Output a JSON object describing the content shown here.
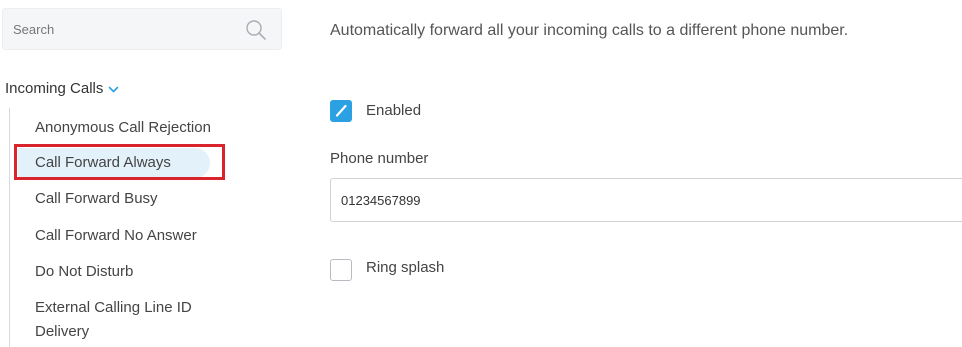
{
  "sidebar": {
    "search": {
      "placeholder": "Search",
      "value": ""
    },
    "section": {
      "title": "Incoming Calls"
    },
    "items": [
      {
        "label": "Anonymous Call Rejection"
      },
      {
        "label": "Call Forward Always"
      },
      {
        "label": "Call Forward Busy"
      },
      {
        "label": "Call Forward No Answer"
      },
      {
        "label": "Do Not Disturb"
      },
      {
        "label": "External Calling Line ID"
      },
      {
        "label": "Delivery"
      }
    ]
  },
  "main": {
    "description": "Automatically forward all your incoming calls to a different phone number.",
    "enabled": {
      "label": "Enabled",
      "checked": true
    },
    "phone": {
      "label": "Phone number",
      "value": "01234567899"
    },
    "ring_splash": {
      "label": "Ring splash",
      "checked": false
    }
  },
  "colors": {
    "accent": "#2ba1e4",
    "selected_background": "#e3f1fb",
    "highlight": "#d9232d"
  }
}
